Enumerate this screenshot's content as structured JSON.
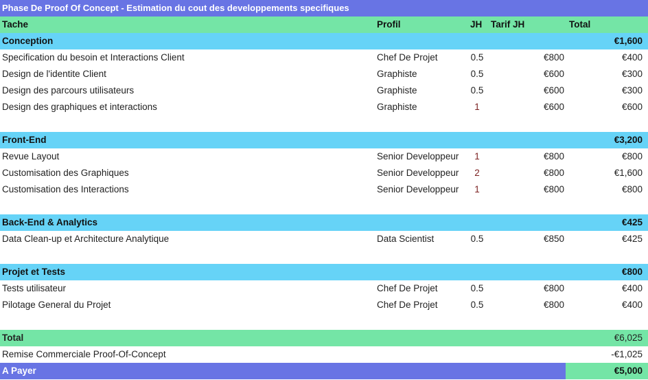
{
  "title": "Phase De Proof Of Concept - Estimation du cout des developpements specifiques",
  "headers": {
    "tache": "Tache",
    "profil": "Profil",
    "jh": "JH",
    "tarif": "Tarif JH",
    "total": "Total"
  },
  "sections": [
    {
      "name": "Conception",
      "total": "€1,600",
      "rows": [
        {
          "tache": "Specification du besoin et Interactions Client",
          "profil": "Chef De Projet",
          "jh": "0.5",
          "tarif": "€800",
          "total": "€400"
        },
        {
          "tache": "Design de l'identite Client",
          "profil": "Graphiste",
          "jh": "0.5",
          "tarif": "€600",
          "total": "€300"
        },
        {
          "tache": "Design des parcours utilisateurs",
          "profil": "Graphiste",
          "jh": "0.5",
          "tarif": "€600",
          "total": "€300"
        },
        {
          "tache": "Design des graphiques et interactions",
          "profil": "Graphiste",
          "jh": "1",
          "tarif": "€600",
          "total": "€600"
        }
      ]
    },
    {
      "name": "Front-End",
      "total": "€3,200",
      "rows": [
        {
          "tache": "Revue Layout",
          "profil": "Senior Developpeur",
          "jh": "1",
          "tarif": "€800",
          "total": "€800"
        },
        {
          "tache": "Customisation des Graphiques",
          "profil": "Senior Developpeur",
          "jh": "2",
          "tarif": "€800",
          "total": "€1,600"
        },
        {
          "tache": "Customisation des Interactions",
          "profil": "Senior Developpeur",
          "jh": "1",
          "tarif": "€800",
          "total": "€800"
        }
      ]
    },
    {
      "name": "Back-End & Analytics",
      "total": "€425",
      "rows": [
        {
          "tache": "Data Clean-up et Architecture Analytique",
          "profil": "Data Scientist",
          "jh": "0.5",
          "tarif": "€850",
          "total": "€425"
        }
      ]
    },
    {
      "name": "Projet et Tests",
      "total": "€800",
      "rows": [
        {
          "tache": "Tests utilisateur",
          "profil": "Chef De Projet",
          "jh": "0.5",
          "tarif": "€800",
          "total": "€400"
        },
        {
          "tache": "Pilotage General du Projet",
          "profil": "Chef De Projet",
          "jh": "0.5",
          "tarif": "€800",
          "total": "€400"
        }
      ]
    }
  ],
  "summary": {
    "total_label": "Total",
    "total": "€6,025",
    "remise_label": "Remise Commerciale Proof-Of-Concept",
    "remise": "-€1,025",
    "payer_label": "A Payer",
    "payer": "€5,000"
  },
  "colors": {
    "purple": "#6874e4",
    "green": "#74e5a6",
    "blue": "#66d3f7"
  }
}
